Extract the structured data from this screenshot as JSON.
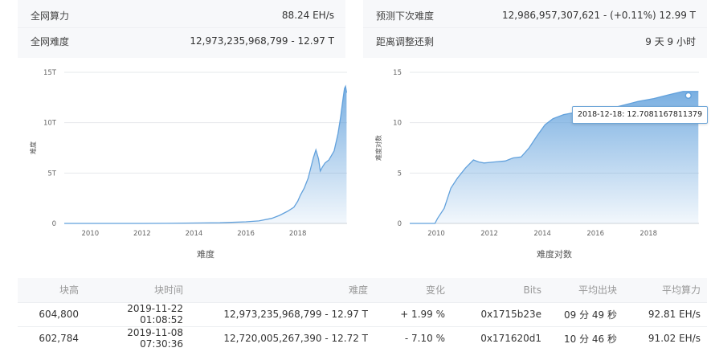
{
  "stats": {
    "hashrate": {
      "label": "全网算力",
      "value": "88.24 EH/s"
    },
    "difficulty": {
      "label": "全网难度",
      "value": "12,973,235,968,799 - 12.97 T"
    },
    "predicted": {
      "label": "预测下次难度",
      "value": "12,986,957,307,621 - (+0.11%) 12.99 T"
    },
    "remaining": {
      "label": "距离调整还剩",
      "value": "9 天 9 小时"
    }
  },
  "chart_data": [
    {
      "type": "area",
      "xlabel": "难度",
      "ylabel": "难度",
      "x_ticks": [
        "2010",
        "2012",
        "2014",
        "2016",
        "2018"
      ],
      "y_ticks": [
        "0",
        "5T",
        "10T",
        "15T"
      ],
      "xlim": [
        2009.0,
        2019.9
      ],
      "ylim": [
        0,
        15
      ],
      "y_unit": "T",
      "color": "#62a1dc",
      "x": [
        2009.0,
        2010.0,
        2011.0,
        2012.0,
        2013.0,
        2014.0,
        2015.0,
        2016.0,
        2016.5,
        2017.0,
        2017.3,
        2017.6,
        2017.85,
        2018.0,
        2018.1,
        2018.25,
        2018.4,
        2018.5,
        2018.6,
        2018.7,
        2018.8,
        2018.87,
        2018.95,
        2019.05,
        2019.2,
        2019.4,
        2019.55,
        2019.65,
        2019.75,
        2019.8,
        2019.84,
        2019.88
      ],
      "y": [
        0,
        0,
        0,
        0.001,
        0.01,
        0.04,
        0.06,
        0.16,
        0.25,
        0.5,
        0.8,
        1.2,
        1.6,
        2.2,
        2.8,
        3.5,
        4.5,
        5.5,
        6.5,
        7.3,
        6.4,
        5.2,
        5.6,
        6.0,
        6.3,
        7.2,
        8.9,
        10.5,
        12.5,
        13.4,
        13.6,
        12.97
      ]
    },
    {
      "type": "area",
      "xlabel": "难度对数",
      "ylabel": "难度对数",
      "x_ticks": [
        "2010",
        "2012",
        "2014",
        "2016",
        "2018"
      ],
      "y_ticks": [
        "0",
        "5",
        "10",
        "15"
      ],
      "xlim": [
        2009.0,
        2019.9
      ],
      "ylim": [
        0,
        15
      ],
      "color": "#62a1dc",
      "x": [
        2009.0,
        2009.95,
        2010.05,
        2010.3,
        2010.55,
        2010.8,
        2011.1,
        2011.4,
        2011.6,
        2011.8,
        2012.2,
        2012.6,
        2012.9,
        2013.2,
        2013.5,
        2013.8,
        2014.1,
        2014.4,
        2014.8,
        2015.2,
        2015.8,
        2016.4,
        2017.0,
        2017.6,
        2018.2,
        2018.8,
        2019.3,
        2019.88
      ],
      "y": [
        0,
        0,
        0.5,
        1.5,
        3.5,
        4.5,
        5.5,
        6.3,
        6.1,
        6.0,
        6.1,
        6.2,
        6.5,
        6.6,
        7.5,
        8.7,
        9.8,
        10.4,
        10.8,
        11.0,
        11.1,
        11.3,
        11.7,
        12.1,
        12.4,
        12.8,
        13.1,
        13.1
      ],
      "tooltip": {
        "text": "2018-12-18: 12.7081167811379",
        "x": 2019.5,
        "y": 12.7
      }
    }
  ],
  "table": {
    "headers": [
      "块高",
      "块时间",
      "难度",
      "变化",
      "Bits",
      "平均出块",
      "平均算力"
    ],
    "rows": [
      [
        "604,800",
        "2019-11-22 01:08:52",
        "12,973,235,968,799 - 12.97 T",
        "+ 1.99 %",
        "0x1715b23e",
        "09 分 49 秒",
        "92.81 EH/s"
      ],
      [
        "602,784",
        "2019-11-08 07:30:36",
        "12,720,005,267,390 - 12.72 T",
        "- 7.10 %",
        "0x171620d1",
        "10 分 46 秒",
        "91.02 EH/s"
      ]
    ]
  }
}
